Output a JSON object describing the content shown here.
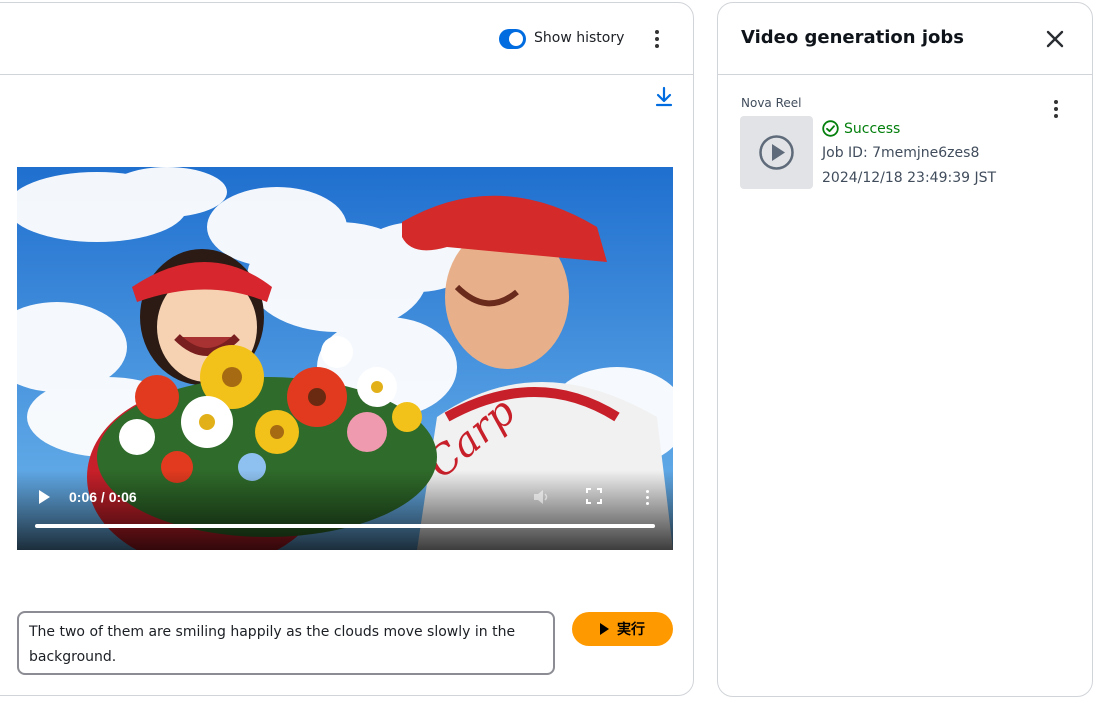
{
  "header": {
    "show_history_label": "Show history",
    "show_history_enabled": true
  },
  "video": {
    "time_display": "0:06 / 0:06",
    "progress": 1.0
  },
  "prompt": {
    "value": "The two of them are smiling happily as the clouds move slowly in the background."
  },
  "run_button": {
    "label": "実行"
  },
  "jobs_panel": {
    "title": "Video generation jobs",
    "jobs": [
      {
        "model": "Nova Reel",
        "status": "Success",
        "job_id": "Job ID: 7memjne6zes8",
        "date": "2024/12/18 23:49:39 JST"
      }
    ]
  },
  "colors": {
    "accent": "#006ce0",
    "run_button": "#ff9900",
    "success": "#037f0c"
  }
}
